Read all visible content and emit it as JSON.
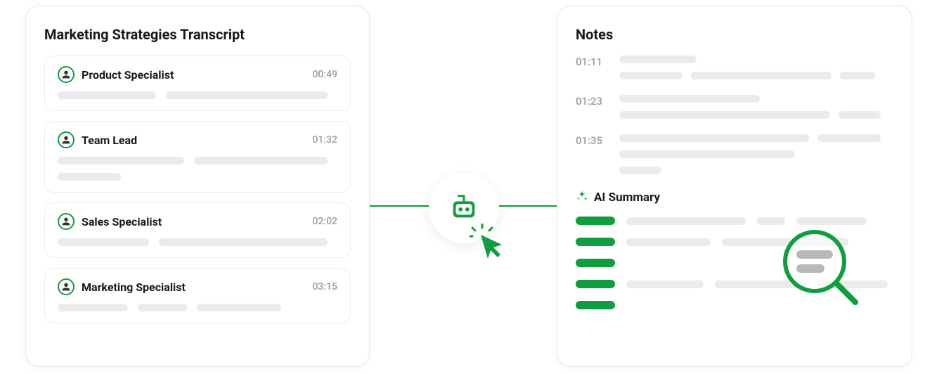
{
  "colors": {
    "accent": "#0f9d3f",
    "skeleton": "#ebebeb",
    "text_muted": "#9a9a9a"
  },
  "transcript": {
    "title": "Marketing Strategies Transcript",
    "items": [
      {
        "speaker": "Product Specialist",
        "time": "00:49",
        "avatar_icon": "person-avatar-1"
      },
      {
        "speaker": "Team Lead",
        "time": "01:32",
        "avatar_icon": "person-avatar-2"
      },
      {
        "speaker": "Sales Specialist",
        "time": "02:02",
        "avatar_icon": "person-avatar-3"
      },
      {
        "speaker": "Marketing Specialist",
        "time": "03:15",
        "avatar_icon": "person-avatar-4"
      }
    ]
  },
  "notes": {
    "title": "Notes",
    "entries": [
      {
        "time": "01:11"
      },
      {
        "time": "01:23"
      },
      {
        "time": "01:35"
      }
    ],
    "ai_summary": {
      "title": "AI Summary",
      "sparkle_icon": "sparkle-icon",
      "magnifier_icon": "magnifier-icon"
    }
  },
  "center": {
    "bot_icon": "bot-icon",
    "cursor_icon": "cursor-click-icon"
  }
}
